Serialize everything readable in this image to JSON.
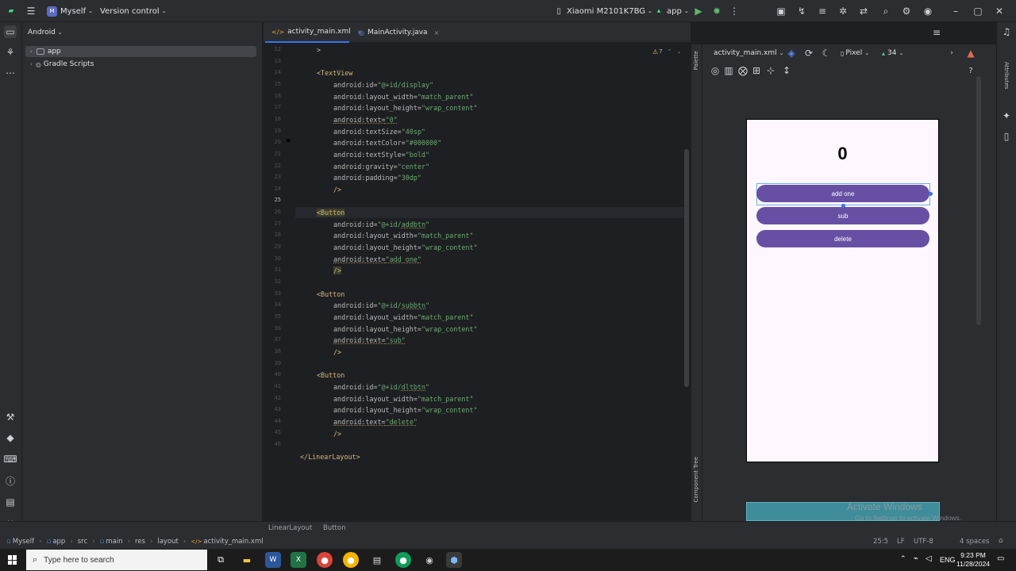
{
  "titlebar": {
    "project_badge": "M",
    "project_name": "Myself",
    "vcs": "Version control",
    "device": "Xiaomi M2101K7BG",
    "run_config": "app"
  },
  "project_panel": {
    "view": "Android",
    "items": [
      {
        "label": "app",
        "selected": true
      },
      {
        "label": "Gradle Scripts",
        "selected": false
      }
    ]
  },
  "tabs": [
    {
      "label": "activity_main.xml",
      "active": true
    },
    {
      "label": "MainActivity.java",
      "active": false
    }
  ],
  "editor": {
    "warnings": "7",
    "line_numbers": [
      "12",
      "13",
      "14",
      "15",
      "16",
      "17",
      "18",
      "19",
      "20",
      "21",
      "22",
      "23",
      "24",
      "25",
      "26",
      "27",
      "28",
      "29",
      "30",
      "31",
      "32",
      "33",
      "34",
      "35",
      "36",
      "37",
      "38",
      "39",
      "40",
      "41",
      "42",
      "43",
      "44",
      "45",
      "46"
    ],
    "current_line": "25",
    "breadcrumb": [
      "LinearLayout",
      "Button"
    ]
  },
  "design": {
    "file": "activity_main.xml",
    "device": "Pixel",
    "api": "34",
    "palette_label": "Palette",
    "tree_label": "Component Tree",
    "attributes_label": "Attributes",
    "display_text": "0",
    "buttons": [
      "add one",
      "sub",
      "delete"
    ],
    "watermark_title": "Activate Windows",
    "watermark_sub": "Go to Settings to activate Windows."
  },
  "navbar": {
    "path": [
      "Myself",
      "app",
      "src",
      "main",
      "res",
      "layout",
      "activity_main.xml"
    ],
    "position": "25:5",
    "line_sep": "LF",
    "encoding": "UTF-8",
    "indent": "4 spaces"
  },
  "taskbar": {
    "search_placeholder": "Type here to search",
    "language": "ENG",
    "time": "9:23 PM",
    "date": "11/28/2024"
  }
}
